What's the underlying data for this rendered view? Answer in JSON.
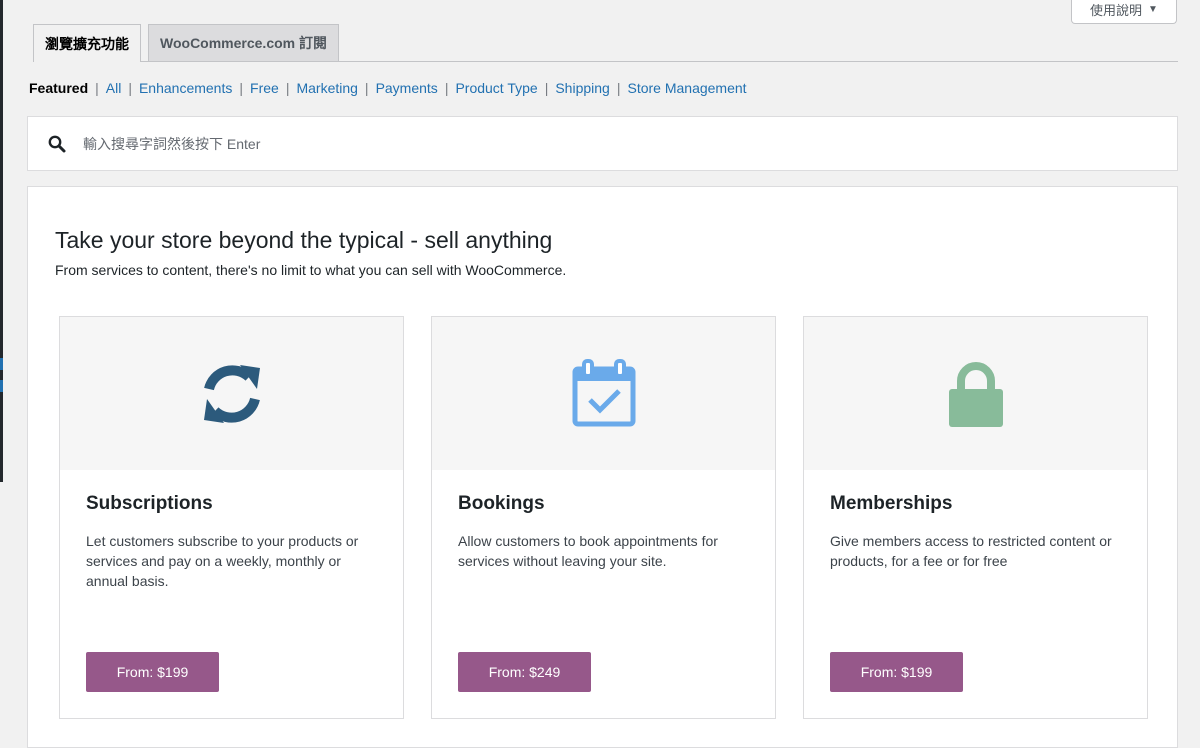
{
  "help": {
    "label": "使用說明"
  },
  "tabs": [
    {
      "label": "瀏覽擴充功能"
    },
    {
      "label": "WooCommerce.com 訂閱"
    }
  ],
  "categories": [
    "Featured",
    "All",
    "Enhancements",
    "Free",
    "Marketing",
    "Payments",
    "Product Type",
    "Shipping",
    "Store Management"
  ],
  "search": {
    "placeholder": "輸入搜尋字詞然後按下 Enter"
  },
  "promo": {
    "title": "Take your store beyond the typical - sell anything",
    "subtitle": "From services to content, there's no limit to what you can sell with WooCommerce."
  },
  "cards": [
    {
      "title": "Subscriptions",
      "description": "Let customers subscribe to your products or services and pay on a weekly, monthly or annual basis.",
      "price_label": "From: $199",
      "icon": "refresh-icon",
      "icon_color": "#2c5a7c"
    },
    {
      "title": "Bookings",
      "description": "Allow customers to book appointments for services without leaving your site.",
      "price_label": "From: $249",
      "icon": "calendar-check-icon",
      "icon_color": "#6aaaea"
    },
    {
      "title": "Memberships",
      "description": "Give members access to restricted content or products, for a fee or for free",
      "price_label": "From: $199",
      "icon": "lock-icon",
      "icon_color": "#88bb9a"
    }
  ],
  "colors": {
    "accent": "#96588a",
    "link": "#2271b1",
    "background": "#f1f1f1"
  }
}
